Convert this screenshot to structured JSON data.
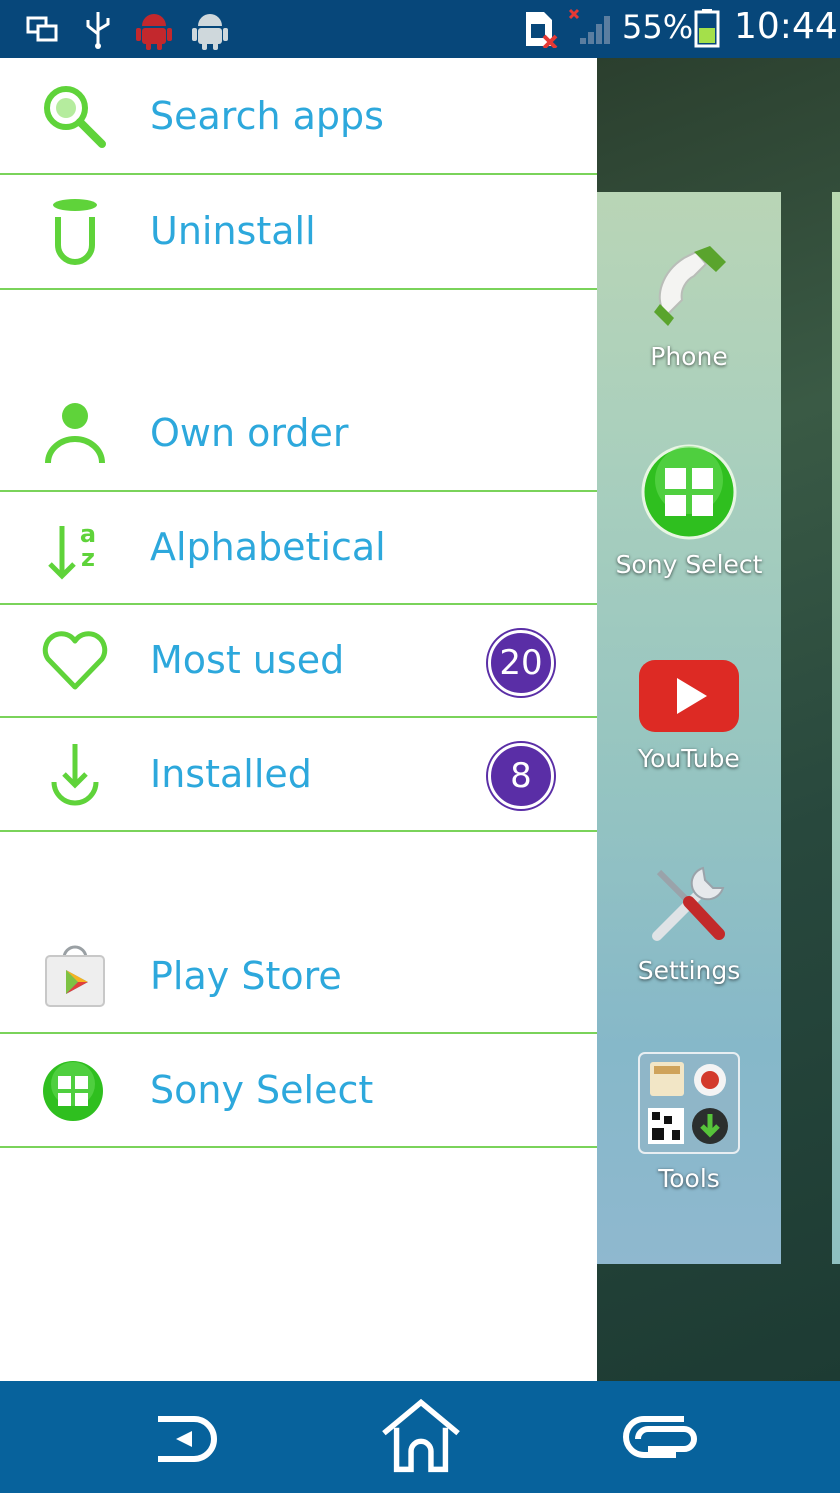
{
  "status": {
    "battery": "55%",
    "time": "10:44"
  },
  "drawer": {
    "search_label": "Search apps",
    "uninstall_label": "Uninstall",
    "own_order_label": "Own order",
    "alphabetical_label": "Alphabetical",
    "most_used_label": "Most used",
    "most_used_count": "20",
    "installed_label": "Installed",
    "installed_count": "8",
    "play_store_label": "Play Store",
    "sony_select_label": "Sony Select"
  },
  "home": {
    "apps": [
      "Phone",
      "Sony Select",
      "YouTube",
      "Settings",
      "Tools"
    ]
  },
  "colors": {
    "accent_green": "#7ad35a",
    "label_blue": "#2da8dc",
    "badge_purple": "#5a2ea6",
    "status_bar": "#07477a",
    "nav_bar": "#07629c"
  }
}
